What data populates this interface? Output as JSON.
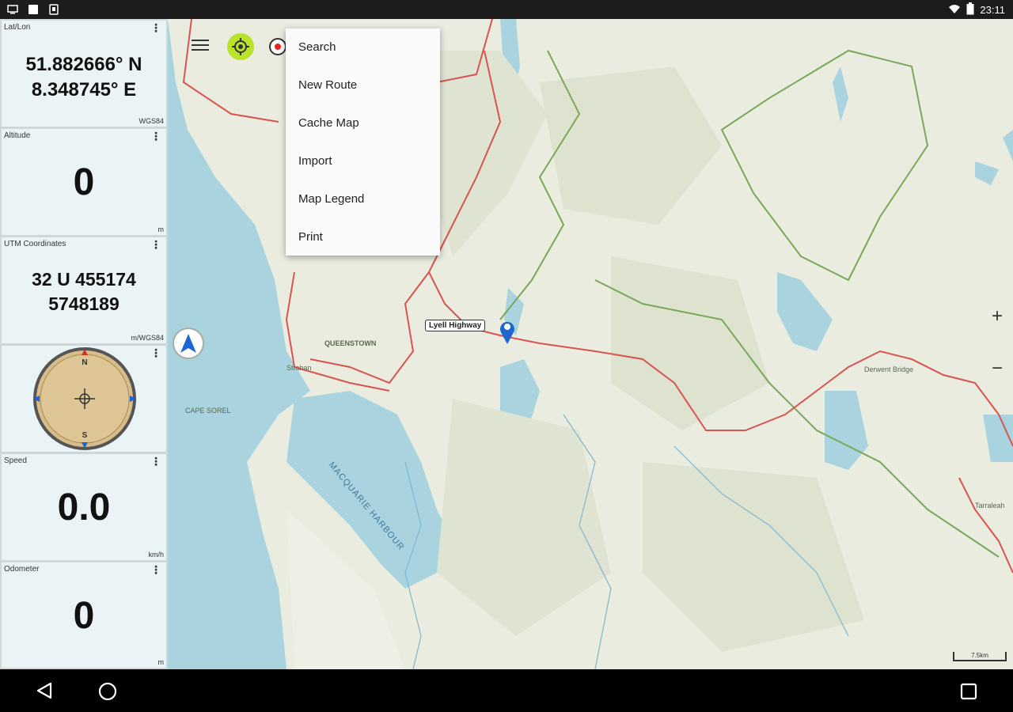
{
  "status_bar": {
    "time": "23:11",
    "icons": [
      "screenshot-icon",
      "notification-icon",
      "sim-icon",
      "wifi-icon",
      "battery-icon"
    ]
  },
  "sidebar": {
    "panels": [
      {
        "title": "Lat/Lon",
        "lines": [
          "51.882666° N",
          "8.348745° E"
        ],
        "unit": "WGS84"
      },
      {
        "title": "Altitude",
        "lines": [
          "0"
        ],
        "unit": "m"
      },
      {
        "title": "UTM Coordinates",
        "lines": [
          "32 U 455174",
          "5748189"
        ],
        "unit": "m/WGS84"
      },
      {
        "title": "",
        "lines": [],
        "unit": ""
      },
      {
        "title": "Speed",
        "lines": [
          "0.0"
        ],
        "unit": "km/h"
      },
      {
        "title": "Odometer",
        "lines": [
          "0"
        ],
        "unit": "m"
      }
    ],
    "compass_letters": {
      "n": "N",
      "s": "S"
    }
  },
  "menu": {
    "items": [
      "Search",
      "New Route",
      "Cache Map",
      "Import",
      "Map Legend",
      "Print"
    ]
  },
  "map": {
    "marker_label": "Lyell Highway",
    "place_labels": [
      "QUEENSTOWN",
      "Strahan",
      "CAPE SOREL",
      "MACQUARIE HARBOUR",
      "Tarraleah",
      "Derwent Bridge"
    ],
    "scale": "7.5km",
    "zoom_in": "+",
    "zoom_out": "−"
  },
  "colors": {
    "water": "#a9d3de",
    "land": "#e9ecdf",
    "road": "#d9534f",
    "park_border": "#7aa85a",
    "gps_button": "#b9e22a"
  }
}
